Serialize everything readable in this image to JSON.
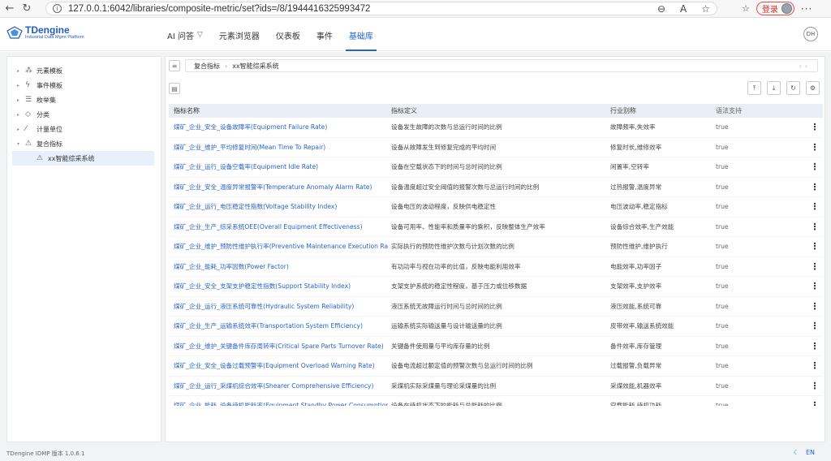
{
  "browser": {
    "url": "127.0.0.1:6042/libraries/composite-metric/set?ids=/8/1944416325993472",
    "login_label": "登录"
  },
  "app": {
    "logo_title": "TDengine",
    "logo_subtitle": "Industrial Data Mgmt Platform",
    "nav": [
      "AI 问答",
      "元素浏览器",
      "仪表板",
      "事件",
      "基础库"
    ],
    "active_nav": "基础库",
    "user_initials": "DH"
  },
  "sidebar": {
    "items": [
      {
        "label": "元素模板",
        "icon": "element-template-icon"
      },
      {
        "label": "事件模板",
        "icon": "event-template-icon"
      },
      {
        "label": "枚举集",
        "icon": "enum-icon"
      },
      {
        "label": "分类",
        "icon": "tag-icon"
      },
      {
        "label": "计量单位",
        "icon": "ruler-icon"
      },
      {
        "label": "复合指标",
        "icon": "composite-icon"
      }
    ],
    "child": "xx智能综采系统"
  },
  "breadcrumb": [
    "复合指标",
    "xx智能综采系统"
  ],
  "table": {
    "headers": [
      "指标名称",
      "指标定义",
      "行业别称",
      "语法支持"
    ],
    "rows": [
      {
        "name": "煤矿_企业_安全_设备故障率(Equipment Failure Rate)",
        "def": "设备发生故障的次数与总运行时间的比例",
        "alias": "故障频率,失效率",
        "syntax": "true"
      },
      {
        "name": "煤矿_企业_维护_平均修复时间(Mean Time To Repair)",
        "def": "设备从故障发生到修复完成的平均时间",
        "alias": "修复时长,维修效率",
        "syntax": "true"
      },
      {
        "name": "煤矿_企业_运行_设备空载率(Equipment Idle Rate)",
        "def": "设备在空载状态下的时间与总时间的比例",
        "alias": "闲置率,空转率",
        "syntax": "true"
      },
      {
        "name": "煤矿_企业_安全_温度异常报警率(Temperature Anomaly Alarm Rate)",
        "def": "设备温度超过安全阈值的报警次数与总运行时间的比例",
        "alias": "过热报警,温度异常",
        "syntax": "true"
      },
      {
        "name": "煤矿_企业_运行_电压稳定性指数(Voltage Stability Index)",
        "def": "设备电压的波动程度，反映供电稳定性",
        "alias": "电压波动率,稳定指标",
        "syntax": "true"
      },
      {
        "name": "煤矿_企业_生产_综采系统OEE(Overall Equipment Effectiveness)",
        "def": "设备可用率、性能率和质量率的乘积，反映整体生产效率",
        "alias": "设备综合效率,生产效能",
        "syntax": "true"
      },
      {
        "name": "煤矿_企业_维护_预防性维护执行率(Preventive Maintenance Execution Rate)",
        "def": "实际执行的预防性维护次数与计划次数的比例",
        "alias": "预防性维护,维护执行",
        "syntax": "true"
      },
      {
        "name": "煤矿_企业_能耗_功率因数(Power Factor)",
        "def": "有功功率与视在功率的比值，反映电能利用效率",
        "alias": "电能效率,功率因子",
        "syntax": "true"
      },
      {
        "name": "煤矿_企业_安全_支架支护稳定性指数(Support Stability Index)",
        "def": "支架支护系统的稳定性程度，基于压力或位移数据",
        "alias": "支架效率,支护效率",
        "syntax": "true"
      },
      {
        "name": "煤矿_企业_运行_液压系统可靠性(Hydraulic System Reliability)",
        "def": "液压系统无故障运行时间与总时间的比例",
        "alias": "液压效能,系统可靠",
        "syntax": "true"
      },
      {
        "name": "煤矿_企业_生产_运输系统效率(Transportation System Efficiency)",
        "def": "运输系统实际输送量与设计输送量的比例",
        "alias": "皮带效率,输送系统效能",
        "syntax": "true"
      },
      {
        "name": "煤矿_企业_维护_关键备件库存周转率(Critical Spare Parts Turnover Rate)",
        "def": "关键备件使用量与平均库存量的比例",
        "alias": "备件效率,库存管理",
        "syntax": "true"
      },
      {
        "name": "煤矿_企业_安全_设备过载预警率(Equipment Overload Warning Rate)",
        "def": "设备电流超过额定值的预警次数与总运行时间的比例",
        "alias": "过载报警,负载异常",
        "syntax": "true"
      },
      {
        "name": "煤矿_企业_运行_采煤机综合效率(Shearer Comprehensive Efficiency)",
        "def": "采煤机实际采煤量与理论采煤量的比例",
        "alias": "采煤效能,机器效率",
        "syntax": "true"
      },
      {
        "name": "煤矿_企业_能耗_设备待机能耗率(Equipment Standby Power Consumption Rate)",
        "def": "设备在待机状态下的能耗与总能耗的比例",
        "alias": "空载能耗,待机功耗",
        "syntax": "true"
      }
    ]
  },
  "footer": {
    "version": "TDengine IDMP 版本 1.0.6.1",
    "lang": "EN"
  }
}
